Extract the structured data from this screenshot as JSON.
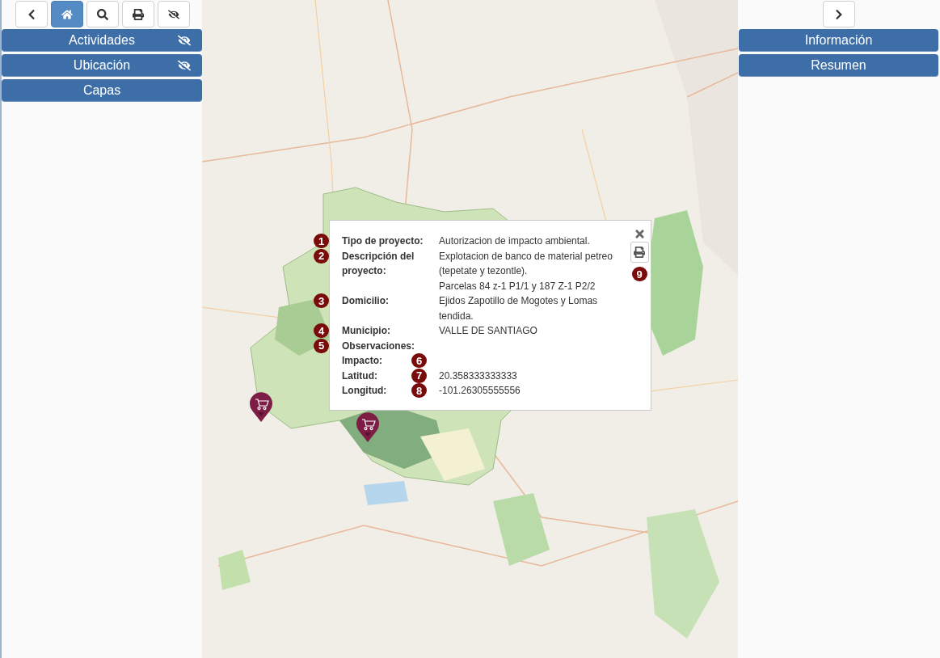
{
  "left_panel": {
    "toolbar": [
      {
        "selected": false
      },
      {
        "selected": true
      },
      {
        "selected": false
      },
      {
        "selected": false
      },
      {
        "selected": false
      }
    ],
    "sections": [
      {
        "label": "Actividades",
        "visibility_toggle": true
      },
      {
        "label": "Ubicación",
        "visibility_toggle": true
      },
      {
        "label": "Capas",
        "visibility_toggle": false
      }
    ]
  },
  "popup": {
    "rows": [
      {
        "badge": "1",
        "badge_after_label": false,
        "label": "Tipo de proyecto:",
        "value": [
          "Autorizacion de impacto ambiental."
        ]
      },
      {
        "badge": "2",
        "badge_after_label": false,
        "label": "Descripción del proyecto:",
        "value": [
          "Explotacion de banco de material petreo (tepetate y tezontle).",
          "Parcelas 84 z-1 P1/1 y 187 Z-1 P2/2"
        ]
      },
      {
        "badge": "3",
        "badge_after_label": false,
        "label": "Domicilio:",
        "value": [
          "Ejidos Zapotillo de Mogotes y Lomas tendida."
        ]
      },
      {
        "badge": "4",
        "badge_after_label": false,
        "label": "Municipio:",
        "value": [
          "VALLE DE SANTIAGO"
        ]
      },
      {
        "badge": "5",
        "badge_after_label": false,
        "label": "Observaciones:",
        "value": []
      },
      {
        "badge": "6",
        "badge_after_label": true,
        "label": "Impacto:",
        "value": []
      },
      {
        "badge": "7",
        "badge_after_label": true,
        "label": "Latitud:",
        "value": [
          "20.358333333333"
        ]
      },
      {
        "badge": "8",
        "badge_after_label": true,
        "label": "Longitud:",
        "value": [
          "-101.26305555556"
        ]
      }
    ],
    "print_badge": "9"
  },
  "right_panel": {
    "sections": [
      {
        "label": "Información"
      },
      {
        "label": "Resumen"
      }
    ]
  }
}
